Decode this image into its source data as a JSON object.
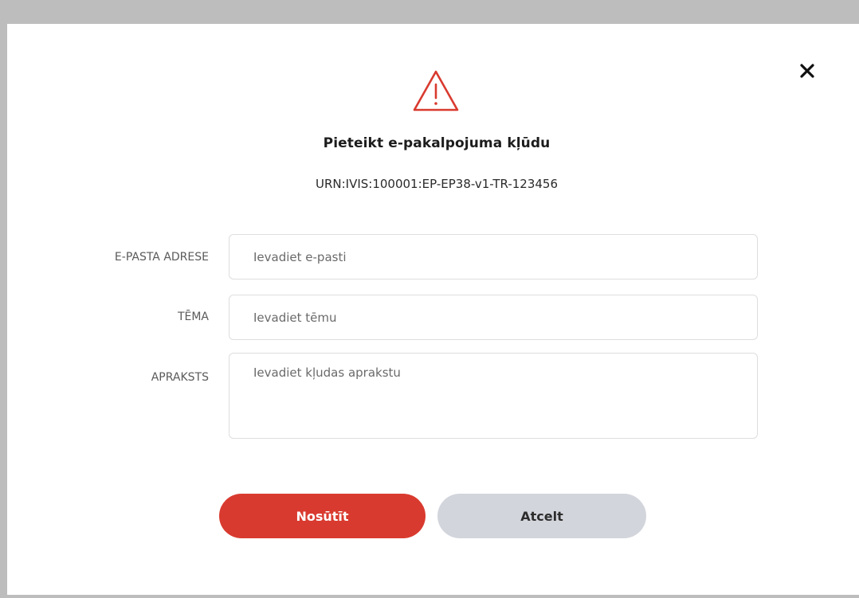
{
  "dialog": {
    "title": "Pieteikt e-pakalpojuma kļūdu",
    "urn": "URN:IVIS:100001:EP-EP38-v1-TR-123456",
    "icon": "warning-triangle-icon",
    "close_icon": "close-icon",
    "accent_color": "#d93a2f"
  },
  "form": {
    "email": {
      "label": "E-PASTA ADRESE",
      "placeholder": "Ievadiet e-pasti",
      "value": ""
    },
    "subject": {
      "label": "TĒMA",
      "placeholder": "Ievadiet tēmu",
      "value": ""
    },
    "description": {
      "label": "APRAKSTS",
      "placeholder": "Ievadiet kļudas aprakstu",
      "value": ""
    }
  },
  "buttons": {
    "send_label": "Nosūtīt",
    "cancel_label": "Atcelt"
  }
}
